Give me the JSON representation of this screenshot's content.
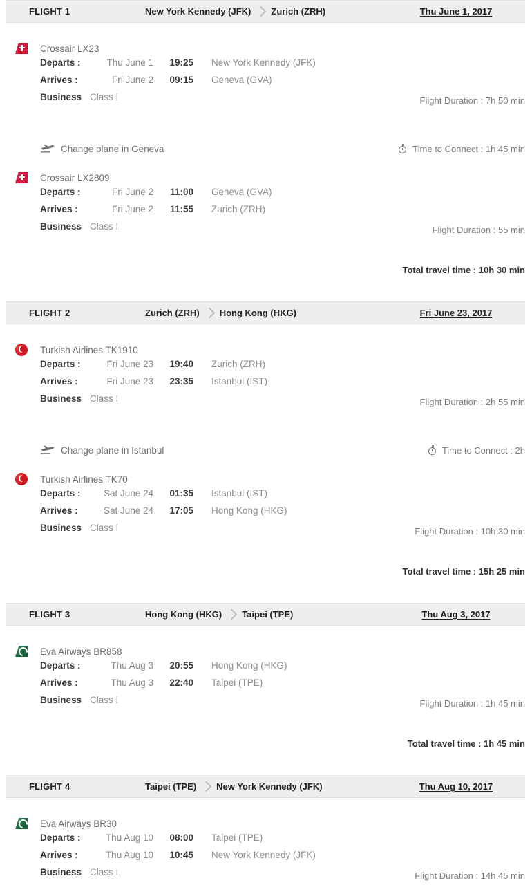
{
  "colors": {
    "header_bg": "#eeeeee",
    "swiss_red": "#d7143a",
    "turkish_red": "#cf1822",
    "eva_green": "#1d6b45",
    "label_text": "#3a3a3a",
    "muted_text": "#8d8d8d"
  },
  "labels": {
    "departs": "Departs :",
    "arrives": "Arrives :",
    "flight_duration_prefix": "Flight Duration : ",
    "total_travel_prefix": "Total travel time : ",
    "time_to_connect_prefix": "Time to Connect : "
  },
  "flights": [
    {
      "header": {
        "label": "FLIGHT 1",
        "origin": "New York Kennedy (JFK)",
        "destination": "Zurich (ZRH)",
        "date": "Thu June 1, 2017"
      },
      "segments": [
        {
          "airline_logo": "swiss-tailfin-icon",
          "airline": "Crossair LX23",
          "departs_date": "Thu June 1",
          "departs_time": "19:25",
          "departs_place": "New York Kennedy (JFK)",
          "arrives_date": "Fri June 2",
          "arrives_time": "09:15",
          "arrives_place": "Geneva (GVA)",
          "cabin": "Business",
          "class_code": "Class I",
          "duration": "Flight Duration : 7h 50 min"
        },
        {
          "airline_logo": "swiss-tailfin-icon",
          "airline": "Crossair LX2809",
          "departs_date": "Fri June 2",
          "departs_time": "11:00",
          "departs_place": "Geneva (GVA)",
          "arrives_date": "Fri June 2",
          "arrives_time": "11:55",
          "arrives_place": "Zurich (ZRH)",
          "cabin": "Business",
          "class_code": "Class I",
          "duration": "Flight Duration : 55 min"
        }
      ],
      "connections": [
        {
          "text": "Change plane in Geneva",
          "connect_time": "Time to Connect : 1h 45 min"
        }
      ],
      "total": "Total travel time : 10h 30 min"
    },
    {
      "header": {
        "label": "FLIGHT 2",
        "origin": "Zurich (ZRH)",
        "destination": "Hong Kong (HKG)",
        "date": "Fri June 23, 2017"
      },
      "segments": [
        {
          "airline_logo": "turkish-roundel-icon",
          "airline": "Turkish Airlines TK1910",
          "departs_date": "Fri June 23",
          "departs_time": "19:40",
          "departs_place": "Zurich (ZRH)",
          "arrives_date": "Fri June 23",
          "arrives_time": "23:35",
          "arrives_place": "Istanbul (IST)",
          "cabin": "Business",
          "class_code": "Class I",
          "duration": "Flight Duration : 2h 55 min"
        },
        {
          "airline_logo": "turkish-roundel-icon",
          "airline": "Turkish Airlines TK70",
          "departs_date": "Sat June 24",
          "departs_time": "01:35",
          "departs_place": "Istanbul (IST)",
          "arrives_date": "Sat June 24",
          "arrives_time": "17:05",
          "arrives_place": "Hong Kong (HKG)",
          "cabin": "Business",
          "class_code": "Class I",
          "duration": "Flight Duration : 10h 30 min"
        }
      ],
      "connections": [
        {
          "text": "Change plane in Istanbul",
          "connect_time": "Time to Connect : 2h"
        }
      ],
      "total": "Total travel time : 15h 25 min"
    },
    {
      "header": {
        "label": "FLIGHT 3",
        "origin": "Hong Kong (HKG)",
        "destination": "Taipei (TPE)",
        "date": "Thu Aug 3, 2017"
      },
      "segments": [
        {
          "airline_logo": "eva-tailfin-icon",
          "airline": "Eva Airways BR858",
          "departs_date": "Thu Aug 3",
          "departs_time": "20:55",
          "departs_place": "Hong Kong (HKG)",
          "arrives_date": "Thu Aug 3",
          "arrives_time": "22:40",
          "arrives_place": "Taipei (TPE)",
          "cabin": "Business",
          "class_code": "Class I",
          "duration": "Flight Duration : 1h 45 min"
        }
      ],
      "connections": [],
      "total": "Total travel time : 1h 45 min"
    },
    {
      "header": {
        "label": "FLIGHT 4",
        "origin": "Taipei (TPE)",
        "destination": "New York Kennedy (JFK)",
        "date": "Thu Aug 10, 2017"
      },
      "segments": [
        {
          "airline_logo": "eva-tailfin-icon",
          "airline": "Eva Airways BR30",
          "departs_date": "Thu Aug 10",
          "departs_time": "08:00",
          "departs_place": "Taipei (TPE)",
          "arrives_date": "Thu Aug 10",
          "arrives_time": "10:45",
          "arrives_place": "New York Kennedy (JFK)",
          "cabin": "Business",
          "class_code": "Class I",
          "duration": "Flight Duration : 14h 45 min"
        }
      ],
      "connections": [],
      "total": ""
    }
  ]
}
